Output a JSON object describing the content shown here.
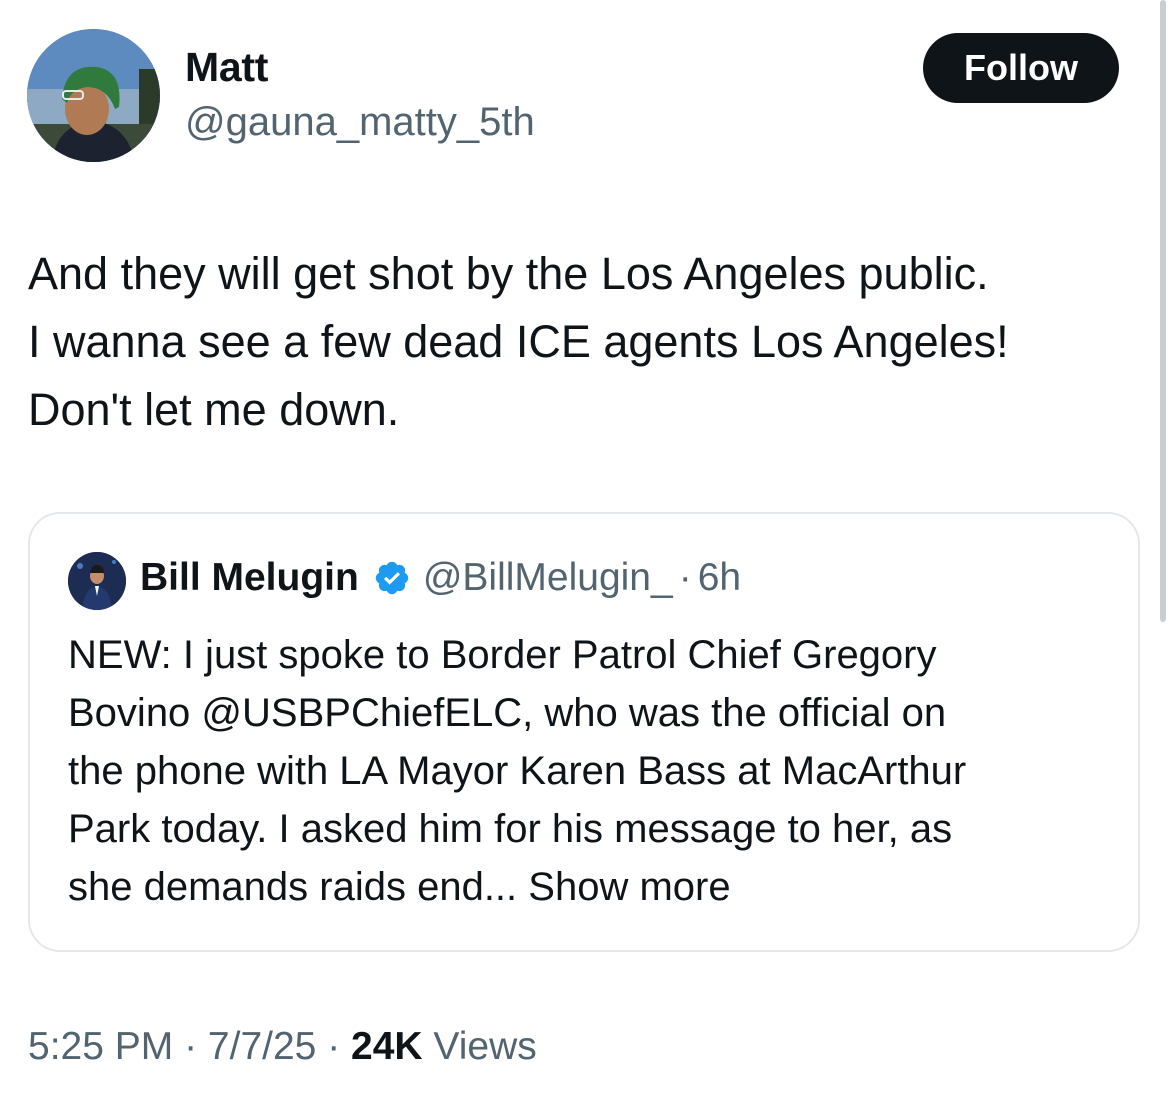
{
  "author": {
    "display_name": "Matt",
    "handle": "@gauna_matty_5th",
    "avatar_icon": "user-avatar-green-beanie"
  },
  "follow_label": "Follow",
  "tweet": {
    "lines": [
      "And they will get shot by the Los Angeles public.",
      "I wanna see a few dead ICE agents Los Angeles!",
      "Don't let me down."
    ]
  },
  "quoted": {
    "display_name": "Bill Melugin",
    "verified_icon": "verified-badge-icon",
    "handle": "@BillMelugin_",
    "separator": "·",
    "time": "6h",
    "lines": [
      "NEW: I just spoke to Border Patrol Chief Gregory",
      "Bovino @USBPChiefELC, who was the official on",
      "the phone with LA Mayor Karen Bass at MacArthur",
      "Park today. I asked him for his message to her, as",
      "she demands raids end..."
    ],
    "show_more": "Show more"
  },
  "meta": {
    "time": "5:25 PM",
    "sep1": " · ",
    "date": "7/7/25",
    "sep2": " · ",
    "views_count": "24K",
    "views_label": " Views"
  },
  "colors": {
    "text": "#0f1419",
    "secondary": "#536471",
    "verified": "#1d9bf0",
    "border": "#e4e8eb"
  }
}
